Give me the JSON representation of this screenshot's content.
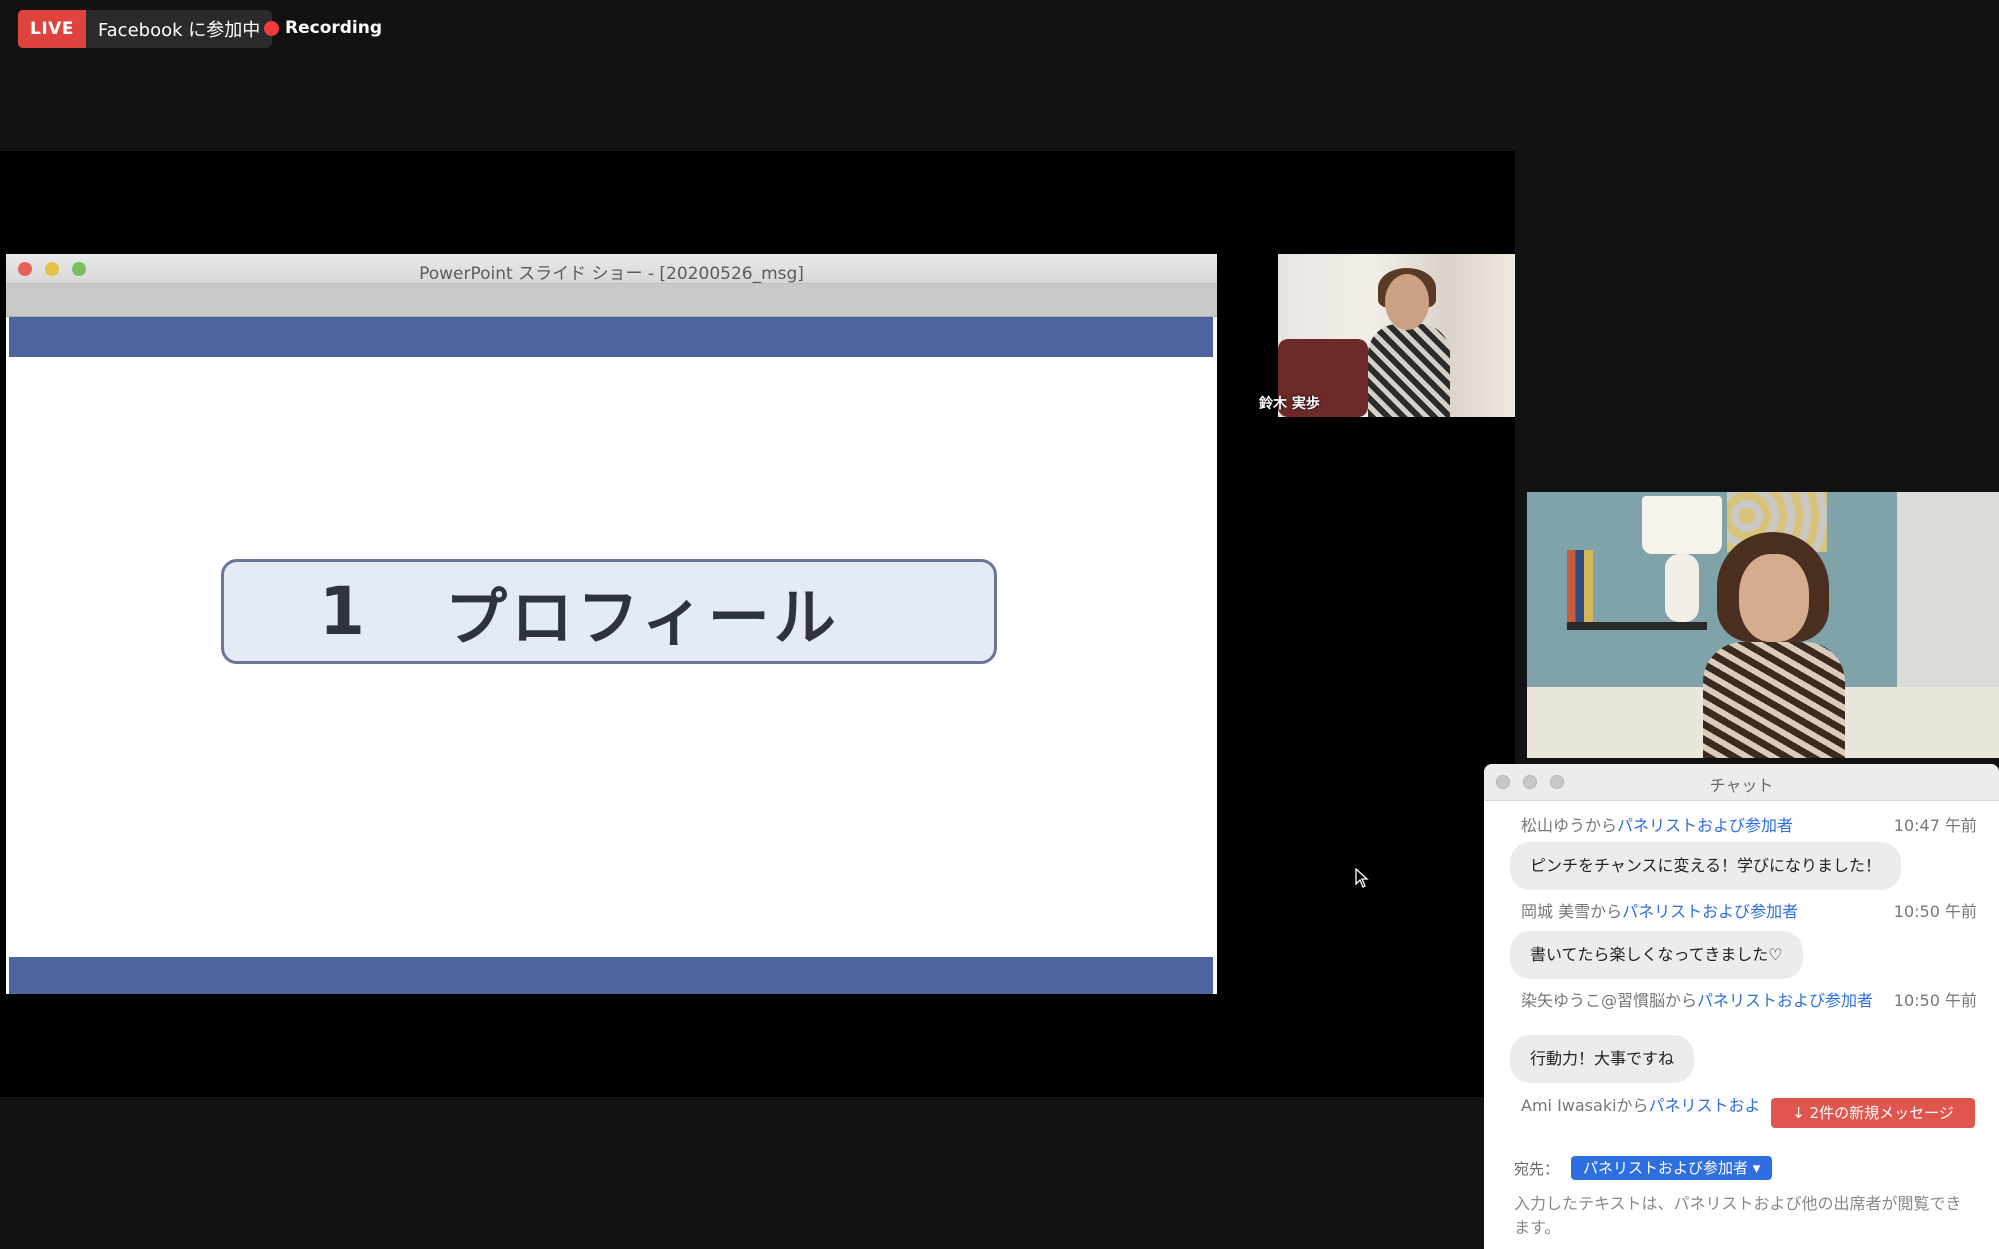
{
  "live": {
    "badge": "LIVE",
    "label": "Facebook に参加中",
    "recording": "Recording"
  },
  "ppt": {
    "window_title": "PowerPoint スライド ショー - [20200526_msg]",
    "slide_number": "1",
    "slide_title": "プロフィール"
  },
  "speaker_small": {
    "name": "鈴木 実歩"
  },
  "chat": {
    "title": "チャット",
    "messages": [
      {
        "from": "松山ゆうから",
        "to": "パネリストおよび参加者",
        "time": "10:47 午前",
        "text": "ピンチをチャンスに変える！学びになりました！"
      },
      {
        "from": "岡城 美雪から",
        "to": "パネリストおよび参加者",
        "time": "10:50 午前",
        "text": "書いてたら楽しくなってきました♡"
      },
      {
        "from": "染矢ゆうこ@習慣脳から",
        "to": "パネリストおよび参加者",
        "time": "10:50 午前",
        "text": "行動力！大事ですね"
      },
      {
        "from": "Ami Iwasakiから",
        "to": "パネリストおよ",
        "time": "",
        "text": ""
      }
    ],
    "new_messages": "↓ 2件の新規メッセージ",
    "to_label": "宛先：",
    "to_value": "パネリストおよび参加者 ▾",
    "hint": "入力したテキストは、パネリストおよび他の出席者が閲覧できます。"
  },
  "colors": {
    "live_red": "#e0433d",
    "slide_band": "#4d649e",
    "link_blue": "#2d6ee0",
    "new_msg_red": "#e0554e"
  }
}
